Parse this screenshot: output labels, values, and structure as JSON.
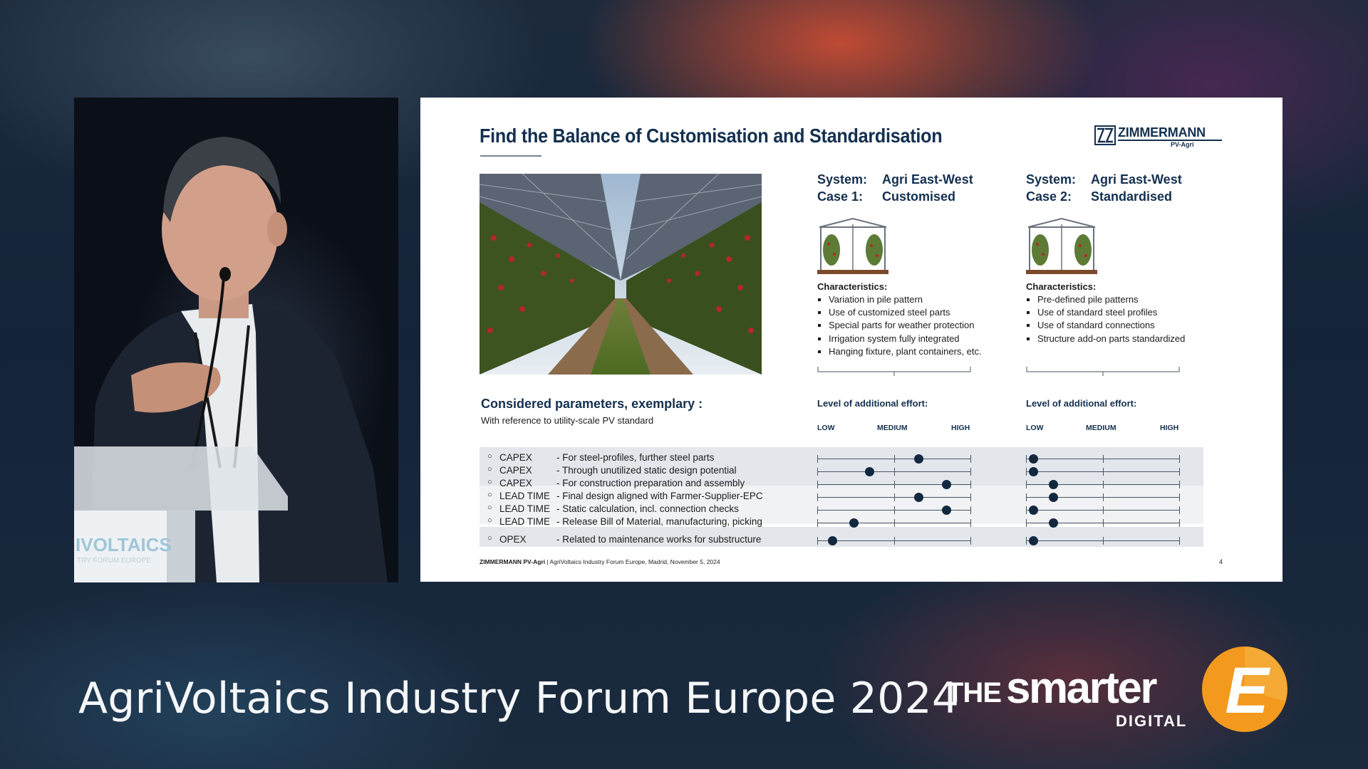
{
  "slide": {
    "title": "Find the Balance of Customisation and Standardisation",
    "logo": {
      "name": "ZIMMERMANN",
      "sub": "PV-Agri"
    },
    "cases": [
      {
        "system_key": "System:",
        "system_val": "Agri East-West",
        "case_key": "Case 1:",
        "case_val": "Customised",
        "chars_heading": "Characteristics:",
        "chars": [
          "Variation in pile pattern",
          "Use of customized steel parts",
          "Special parts for weather protection",
          "Irrigation system fully integrated",
          "Hanging fixture, plant containers, etc."
        ]
      },
      {
        "system_key": "System:",
        "system_val": "Agri East-West",
        "case_key": "Case 2:",
        "case_val": "Standardised",
        "chars_heading": "Characteristics:",
        "chars": [
          "Pre-defined pile patterns",
          "Use of standard steel profiles",
          "Use of standard connections",
          "Structure add-on parts standardized"
        ]
      }
    ],
    "params_heading": "Considered parameters, exemplary :",
    "params_sub": "With reference to utility-scale PV standard",
    "effort_label": "Level of additional effort:",
    "scale_labels": {
      "low": "LOW",
      "medium": "MEDIUM",
      "high": "HIGH"
    },
    "rows": [
      {
        "cat": "CAPEX",
        "desc": "- For steel-profiles, further steel parts",
        "case1": 0.66,
        "case2": 0.05
      },
      {
        "cat": "CAPEX",
        "desc": "- Through unutilized static design potential",
        "case1": 0.34,
        "case2": 0.05
      },
      {
        "cat": "CAPEX",
        "desc": "- For construction preparation and assembly",
        "case1": 0.84,
        "case2": 0.18
      },
      {
        "cat": "LEAD TIME",
        "desc": "- Final design aligned with Farmer-Supplier-EPC",
        "case1": 0.66,
        "case2": 0.18
      },
      {
        "cat": "LEAD TIME",
        "desc": "- Static calculation, incl. connection checks",
        "case1": 0.84,
        "case2": 0.05
      },
      {
        "cat": "LEAD TIME",
        "desc": "- Release Bill of Material, manufacturing, picking",
        "case1": 0.24,
        "case2": 0.18
      },
      {
        "cat": "OPEX",
        "desc": "- Related to maintenance works for substructure",
        "case1": 0.1,
        "case2": 0.05
      }
    ],
    "footer_brand": "ZIMMERMANN PV-Agri",
    "footer_text": " | AgriVoltaics Industry Forum Europe, Madrid, November 5, 2024",
    "page_number": "4"
  },
  "speaker_podium_text": "IVOLTAICS",
  "speaker_podium_sub": "TRY FORUM EUROPE",
  "event_title": "AgriVoltaics Industry Forum Europe 2024",
  "brand": {
    "the": "THE",
    "smarter": "smarter",
    "digital": "DIGITAL",
    "letter": "E",
    "accent_color": "#f39a1e"
  }
}
